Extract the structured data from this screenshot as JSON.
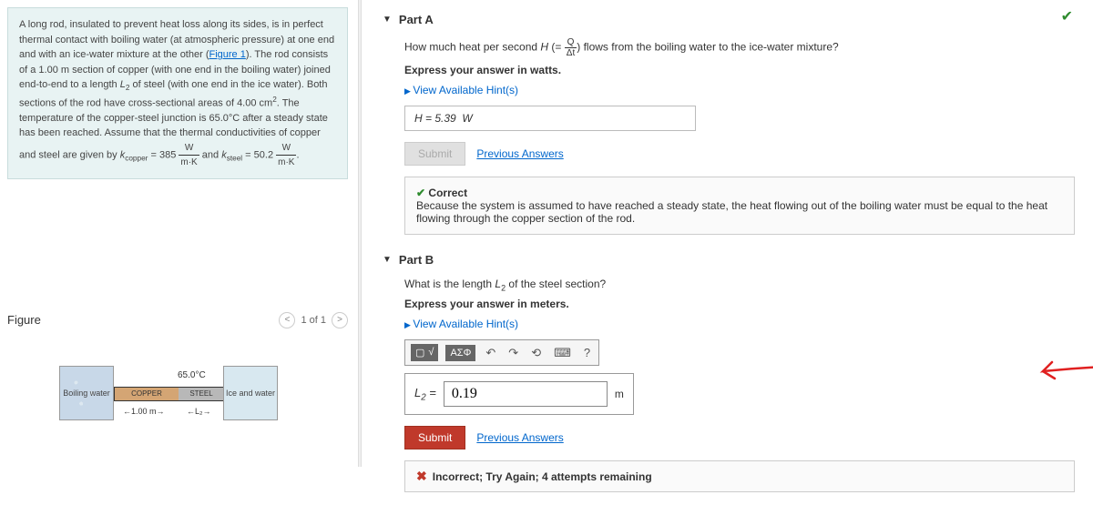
{
  "problem": {
    "text_html": "A long rod, insulated to prevent heat loss along its sides, is in perfect thermal contact with boiling water (at atmospheric pressure) at one end and with an ice-water mixture at the other (Figure 1). The rod consists of a 1.00 m section of copper (with one end in the boiling water) joined end-to-end to a length L₂ of steel (with one end in the ice water). Both sections of the rod have cross-sectional areas of 4.00 cm². The temperature of the copper-steel junction is 65.0°C after a steady state has been reached. Assume that the thermal conductivities of copper and steel are given by k_copper = 385 W/(m·K) and k_steel = 50.2 W/(m·K).",
    "figure_link": "Figure 1"
  },
  "figure": {
    "title": "Figure",
    "nav": "1 of 1",
    "labels": {
      "temp": "65.0°C",
      "copper": "COPPER",
      "steel": "STEEL",
      "boiling": "Boiling water",
      "ice": "Ice and water",
      "dim1": "1.00 m",
      "dim2": "L₂"
    }
  },
  "partA": {
    "title": "Part A",
    "question": "How much heat per second H (= Q/Δt) flows from the boiling water to the ice-water mixture?",
    "instruct": "Express your answer in watts.",
    "hints": "View Available Hint(s)",
    "answer": "H = 5.39 W",
    "submit": "Submit",
    "prev": "Previous Answers",
    "feedback": {
      "status": "Correct",
      "explain": "Because the system is assumed to have reached a steady state, the heat flowing out of the boiling water must be equal to the heat flowing through the copper section of the rod."
    }
  },
  "partB": {
    "title": "Part B",
    "question": "What is the length L₂ of the steel section?",
    "instruct": "Express your answer in meters.",
    "hints": "View Available Hint(s)",
    "toolbar": {
      "greek": "ΑΣΦ",
      "help": "?"
    },
    "answer_label": "L₂ =",
    "answer_value": "0.19",
    "unit": "m",
    "submit": "Submit",
    "prev": "Previous Answers",
    "feedback": "Incorrect; Try Again; 4 attempts remaining"
  }
}
